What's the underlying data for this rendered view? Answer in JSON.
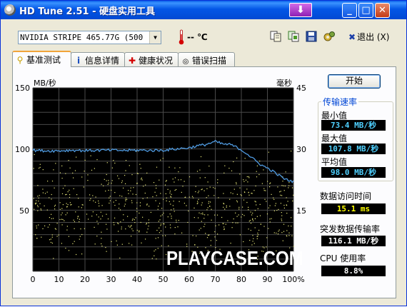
{
  "window": {
    "title": "HD Tune 2.51 - 硬盘实用工具",
    "download_glyph": "⬇",
    "min_glyph": "_",
    "max_glyph": "□",
    "close_glyph": "✕"
  },
  "toolbar": {
    "drive": "NVIDIA  STRIPE   465.77G (500",
    "temperature": "-- ℃",
    "exit_label": "退出 (X)",
    "icons": [
      "copy-text-icon",
      "copy-screenshot-icon",
      "save-icon",
      "options-icon"
    ]
  },
  "tabs": [
    {
      "label": "基准测试",
      "icon": "benchmark-icon",
      "glyph": "⚲"
    },
    {
      "label": "信息详情",
      "icon": "info-icon",
      "glyph": "i"
    },
    {
      "label": "健康状况",
      "icon": "health-icon",
      "glyph": "✚"
    },
    {
      "label": "错误扫描",
      "icon": "error-scan-icon",
      "glyph": "🔍"
    }
  ],
  "chart_data": {
    "type": "line",
    "left_unit": "MB/秒",
    "right_unit": "毫秒",
    "left_ticks": [
      "150",
      "100",
      "50"
    ],
    "right_ticks": [
      "45",
      "30",
      "15"
    ],
    "x_ticks": [
      "0",
      "10",
      "20",
      "30",
      "40",
      "50",
      "60",
      "70",
      "80",
      "90",
      "100%"
    ],
    "ylim": [
      0,
      150
    ],
    "y2lim": [
      0,
      45
    ],
    "xlim": [
      0,
      100
    ],
    "grid": true,
    "background": "#000000",
    "series": [
      {
        "color": "#4f9ae0",
        "x": [
          0,
          5,
          10,
          15,
          20,
          25,
          30,
          35,
          40,
          45,
          50,
          55,
          60,
          63,
          66,
          70,
          73,
          76,
          79,
          82,
          85,
          88,
          91,
          94,
          97,
          100
        ],
        "y": [
          99,
          98.5,
          98.5,
          99,
          98.7,
          98.9,
          99,
          98.8,
          99,
          98.8,
          99,
          100,
          101,
          102.5,
          103.5,
          106,
          104,
          103.5,
          100.5,
          96.5,
          91,
          86.5,
          83.2,
          79,
          75,
          73.4
        ]
      }
    ],
    "access_scatter_color": "#e8e87a",
    "access_time_avg_ms": 15.1
  },
  "results": {
    "start_label": "开始",
    "transfer_title": "传输速率",
    "min_label": "最小值",
    "min_value": "73.4 MB/秒",
    "max_label": "最大值",
    "max_value": "107.8 MB/秒",
    "avg_label": "平均值",
    "avg_value": "98.0 MB/秒",
    "access_label": "数据访问时间",
    "access_value": "15.1 ms",
    "burst_label": "突发数据传输率",
    "burst_value": "116.1 MB/秒",
    "cpu_label": "CPU 使用率",
    "cpu_value": "8.8%"
  },
  "watermark": "PLAYCASE.COM",
  "colors": {
    "title_bar": "#0356e6",
    "accent_blue": "#0046d5",
    "value_cyan": "#4fd0ff",
    "value_yellow": "#ffff00"
  }
}
